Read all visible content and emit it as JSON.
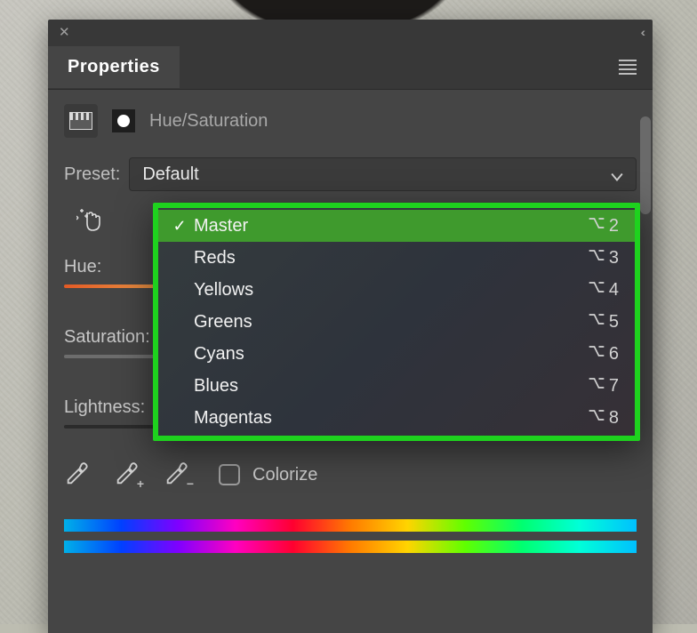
{
  "titlebar": {
    "close_glyph": "✕",
    "collapse_glyph": "‹‹"
  },
  "tab": {
    "label": "Properties"
  },
  "header": {
    "title": "Hue/Saturation"
  },
  "preset": {
    "label": "Preset:",
    "value": "Default"
  },
  "sliders": {
    "hue_label": "Hue:",
    "sat_label": "Saturation:",
    "light_label": "Lightness:"
  },
  "colorize": {
    "label": "Colorize",
    "checked": false
  },
  "range_dropdown": {
    "items": [
      {
        "label": "Master",
        "shortcut": "2",
        "selected": true
      },
      {
        "label": "Reds",
        "shortcut": "3",
        "selected": false
      },
      {
        "label": "Yellows",
        "shortcut": "4",
        "selected": false
      },
      {
        "label": "Greens",
        "shortcut": "5",
        "selected": false
      },
      {
        "label": "Cyans",
        "shortcut": "6",
        "selected": false
      },
      {
        "label": "Blues",
        "shortcut": "7",
        "selected": false
      },
      {
        "label": "Magentas",
        "shortcut": "8",
        "selected": false
      }
    ]
  }
}
